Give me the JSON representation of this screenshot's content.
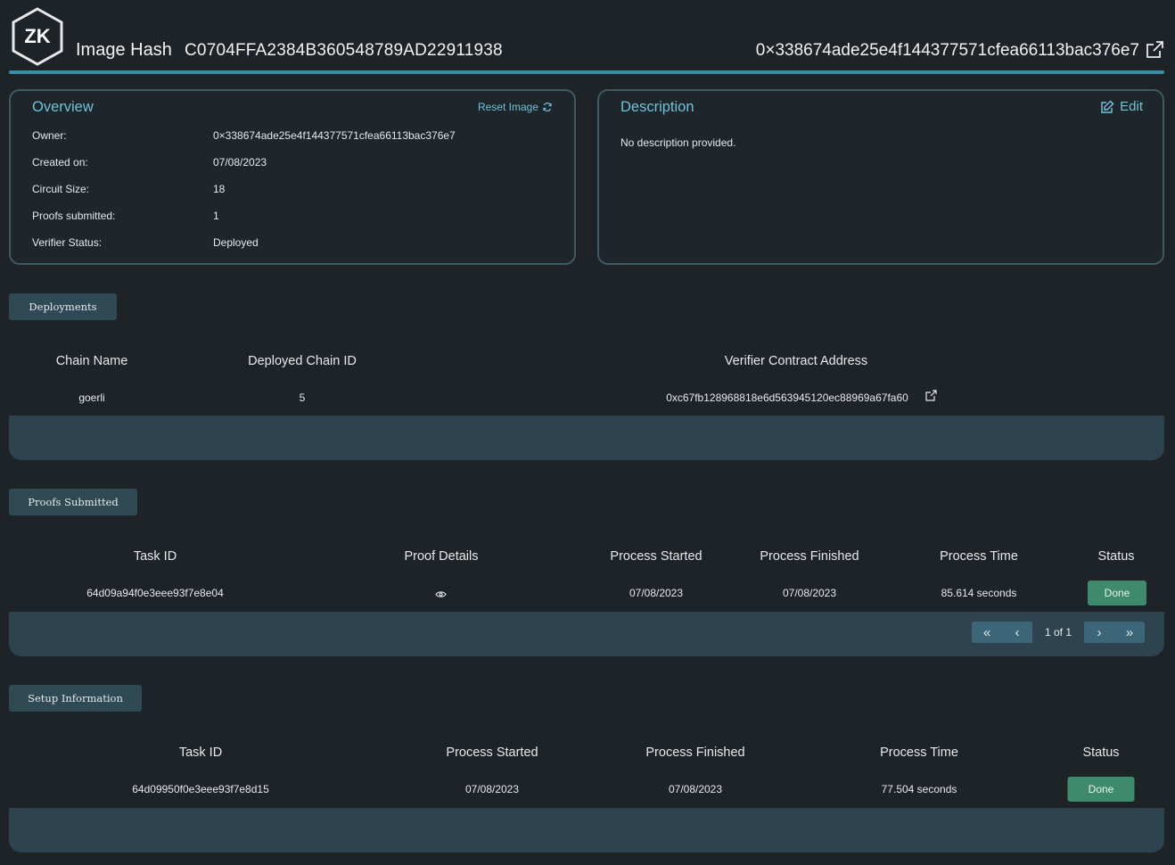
{
  "header": {
    "logo_text": "ZK",
    "image_hash_label": "Image Hash",
    "image_hash_value": "C0704FFA2384B360548789AD22911938",
    "owner_address": "0×338674ade25e4f144377571cfea66113bac376e7"
  },
  "overview": {
    "title": "Overview",
    "reset_label": "Reset Image",
    "rows": [
      {
        "label": "Owner:",
        "value": "0×338674ade25e4f144377571cfea66113bac376e7"
      },
      {
        "label": "Created on:",
        "value": "07/08/2023"
      },
      {
        "label": "Circuit Size:",
        "value": "18"
      },
      {
        "label": "Proofs submitted:",
        "value": "1"
      },
      {
        "label": "Verifier Status:",
        "value": "Deployed"
      }
    ]
  },
  "description": {
    "title": "Description",
    "edit_label": "Edit",
    "text": "No description provided."
  },
  "deployments": {
    "tag": "Deployments",
    "headers": [
      "Chain Name",
      "Deployed Chain ID",
      "Verifier Contract Address"
    ],
    "rows": [
      {
        "chain_name": "goerli",
        "chain_id": "5",
        "address": "0xc67fb128968818e6d563945120ec88969a67fa60"
      }
    ]
  },
  "proofs": {
    "tag": "Proofs Submitted",
    "headers": [
      "Task ID",
      "Proof Details",
      "Process Started",
      "Process Finished",
      "Process Time",
      "Status"
    ],
    "rows": [
      {
        "task_id": "64d09a94f0e3eee93f7e8e04",
        "started": "07/08/2023",
        "finished": "07/08/2023",
        "time": "85.614 seconds",
        "status": "Done"
      }
    ],
    "pager": {
      "first": "«",
      "prev": "‹",
      "label": "1 of 1",
      "next": "›",
      "last": "»"
    }
  },
  "setup": {
    "tag": "Setup Information",
    "headers": [
      "Task ID",
      "Process Started",
      "Process Finished",
      "Process Time",
      "Status"
    ],
    "rows": [
      {
        "task_id": "64d09950f0e3eee93f7e8d15",
        "started": "07/08/2023",
        "finished": "07/08/2023",
        "time": "77.504 seconds",
        "status": "Done"
      }
    ]
  },
  "colors": {
    "background": "#1e2328",
    "accent": "#6fc2d8",
    "header_line": "#3a8fa3",
    "done": "#3f8a6c",
    "footer": "#2d4450"
  }
}
